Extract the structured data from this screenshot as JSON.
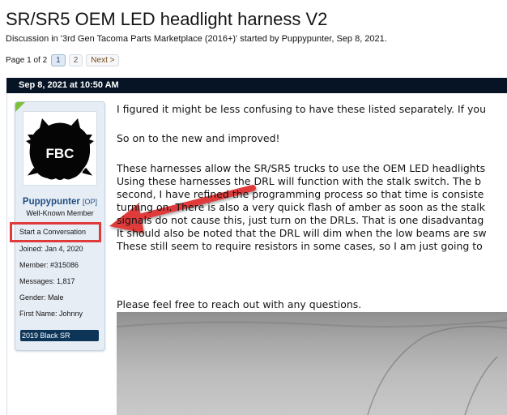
{
  "thread": {
    "title": "SR/SR5 OEM LED headlight harness V2",
    "meta": "Discussion in '3rd Gen Tacoma Parts Marketplace (2016+)' started by Puppypunter, Sep 8, 2021."
  },
  "pagination": {
    "label": "Page 1 of 2",
    "pages": [
      "1",
      "2"
    ],
    "next": "Next >"
  },
  "post": {
    "date": "Sep 8, 2021 at 10:50 AM",
    "lines": [
      "I figured it might be less confusing to have these listed separately. If you",
      "",
      "So on to the new and improved!",
      "",
      "These harnesses allow the SR/SR5 trucks to use the OEM LED headlights",
      "Using these harnesses the DRL will function with the stalk switch. The b",
      "second, I have refined the programming process so that time is consiste",
      "turning on. There is also a very quick flash of amber as soon as the stalk",
      "signals do not cause this, just turn on the DRLs. That is one disadvantag",
      "It should also be noted that the DRL will dim when the low beams are sw",
      "These still seem to require resistors in some cases, so I am just going to",
      "",
      "",
      "Please feel free to reach out with any questions."
    ]
  },
  "user": {
    "avatar_text": "FBC",
    "name": "Puppypunter",
    "op_tag": "[OP]",
    "title": "Well-Known Member",
    "start_conversation": "Start a Conversation",
    "joined": "Joined:  Jan 4, 2020",
    "member": "Member:  #315086",
    "messages": "Messages:  1,817",
    "gender": "Gender:  Male",
    "first_name": "First Name:  Johnny",
    "truck": "2019 Black SR"
  },
  "colors": {
    "annotation": "#e03a3a",
    "header_bg": "#061425",
    "username": "#1f4f82",
    "online": "#7cc03d",
    "badge_bg": "#0d3558"
  },
  "icons": {
    "avatar": "pomeranian-silhouette-icon",
    "online": "online-indicator-icon",
    "annotation": "arrow-annotation"
  }
}
